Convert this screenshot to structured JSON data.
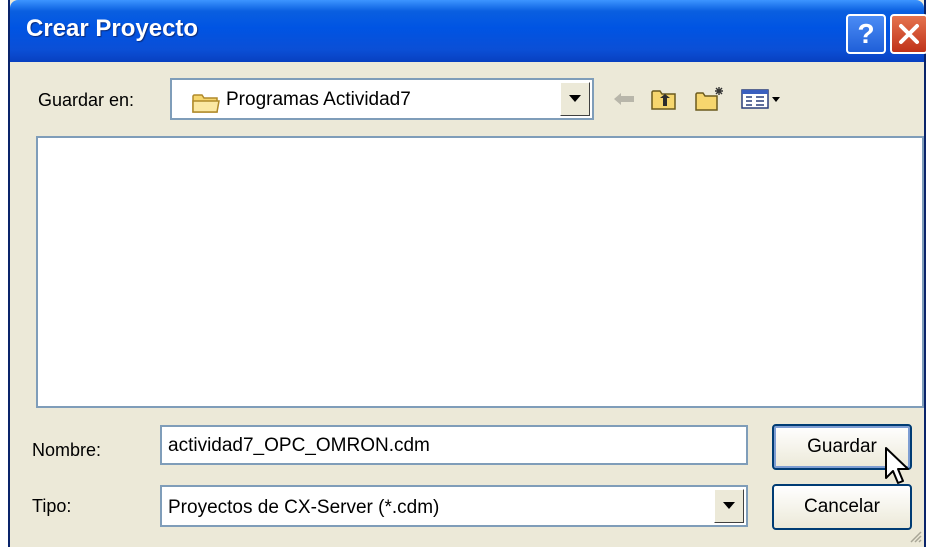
{
  "window": {
    "title": "Crear Proyecto",
    "help_glyph": "?",
    "close_glyph": "×"
  },
  "save_in": {
    "label": "Guardar en:",
    "value": "Programas Actividad7"
  },
  "toolbar": {
    "icons": [
      "back-arrow-icon",
      "up-folder-icon",
      "new-folder-icon",
      "view-menu-icon"
    ]
  },
  "filename": {
    "label": "Nombre:",
    "value": "actividad7_OPC_OMRON.cdm"
  },
  "filetype": {
    "label": "Tipo:",
    "value": "Proyectos de CX-Server (*.cdm)"
  },
  "buttons": {
    "save": "Guardar",
    "cancel": "Cancelar"
  },
  "colors": {
    "titlebar": "#0054e3",
    "dialog_bg": "#ece9d8",
    "input_border": "#7f9db9",
    "close_button": "#c0331a"
  }
}
